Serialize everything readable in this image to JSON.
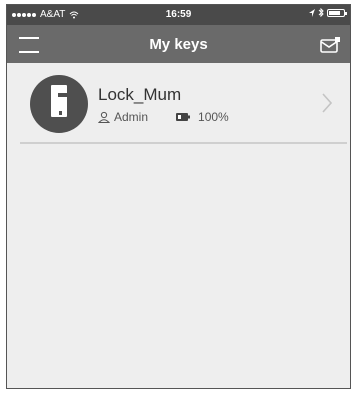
{
  "status_bar": {
    "carrier": "A&AT",
    "time": "16:59",
    "battery_level": 0.8
  },
  "nav": {
    "title": "My keys",
    "left_icon": "menu-icon",
    "right_icon": "mail-icon"
  },
  "locks": [
    {
      "name": "Lock_Mum",
      "role": "Admin",
      "battery": "100%",
      "icon": "lock-icon"
    }
  ]
}
